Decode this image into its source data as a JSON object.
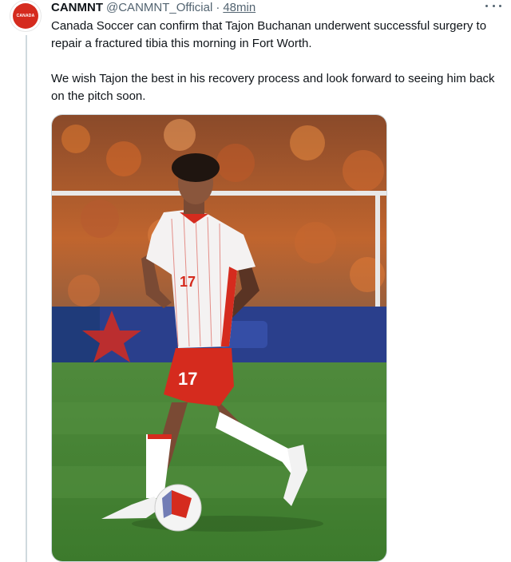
{
  "tweet": {
    "display_name": "CANMNT",
    "handle": "@CANMNT_Official",
    "separator": "·",
    "timestamp": "48min",
    "text_paragraphs": [
      "Canada Soccer can confirm that Tajon Buchanan underwent successful surgery to repair a fractured tibia this morning in Fort Worth.",
      "We wish Tajon the best in his recovery process and look forward to seeing him back on the pitch soon."
    ],
    "avatar": {
      "badge_text": "CANADA",
      "color": "#d52b1e"
    },
    "more_icon": "more-horizontal-icon",
    "media": {
      "shirt_number": "17",
      "description_icon": "photo"
    }
  },
  "colors": {
    "text": "#0f1419",
    "secondary": "#536471",
    "border": "#cfd9de",
    "brand_red": "#d52b1e"
  }
}
